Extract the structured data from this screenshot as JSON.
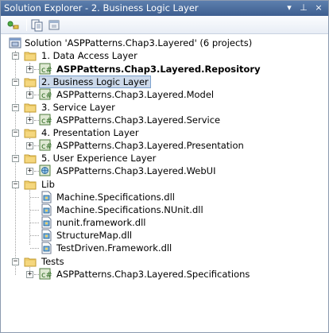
{
  "window": {
    "title": "Solution Explorer - 2. Business Logic Layer",
    "buttons": {
      "dropdown": "▾",
      "pin": "⊥",
      "close": "×"
    }
  },
  "toolbar": {
    "items": [
      {
        "name": "properties-icon"
      },
      {
        "name": "show-all-files-icon"
      },
      {
        "name": "refresh-icon"
      }
    ]
  },
  "tree": {
    "solution": "Solution 'ASPPatterns.Chap3.Layered' (6 projects)",
    "nodes": [
      {
        "label": "1. Data Access Layer",
        "type": "folder"
      },
      {
        "label": "ASPPatterns.Chap3.Layered.Repository",
        "type": "project",
        "bold": true
      },
      {
        "label": "2. Business Logic Layer",
        "type": "folder",
        "selected": true
      },
      {
        "label": "ASPPatterns.Chap3.Layered.Model",
        "type": "project"
      },
      {
        "label": "3. Service Layer",
        "type": "folder"
      },
      {
        "label": "ASPPatterns.Chap3.Layered.Service",
        "type": "project"
      },
      {
        "label": "4. Presentation Layer",
        "type": "folder"
      },
      {
        "label": "ASPPatterns.Chap3.Layered.Presentation",
        "type": "project"
      },
      {
        "label": "5. User Experience Layer",
        "type": "folder"
      },
      {
        "label": "ASPPatterns.Chap3.Layered.WebUI",
        "type": "project"
      },
      {
        "label": "Lib",
        "type": "folder"
      },
      {
        "label": "Machine.Specifications.dll",
        "type": "file"
      },
      {
        "label": "Machine.Specifications.NUnit.dll",
        "type": "file"
      },
      {
        "label": "nunit.framework.dll",
        "type": "file"
      },
      {
        "label": "StructureMap.dll",
        "type": "file"
      },
      {
        "label": "TestDriven.Framework.dll",
        "type": "file"
      },
      {
        "label": "Tests",
        "type": "folder"
      },
      {
        "label": "ASPPatterns.Chap3.Layered.Specifications",
        "type": "project"
      }
    ]
  }
}
